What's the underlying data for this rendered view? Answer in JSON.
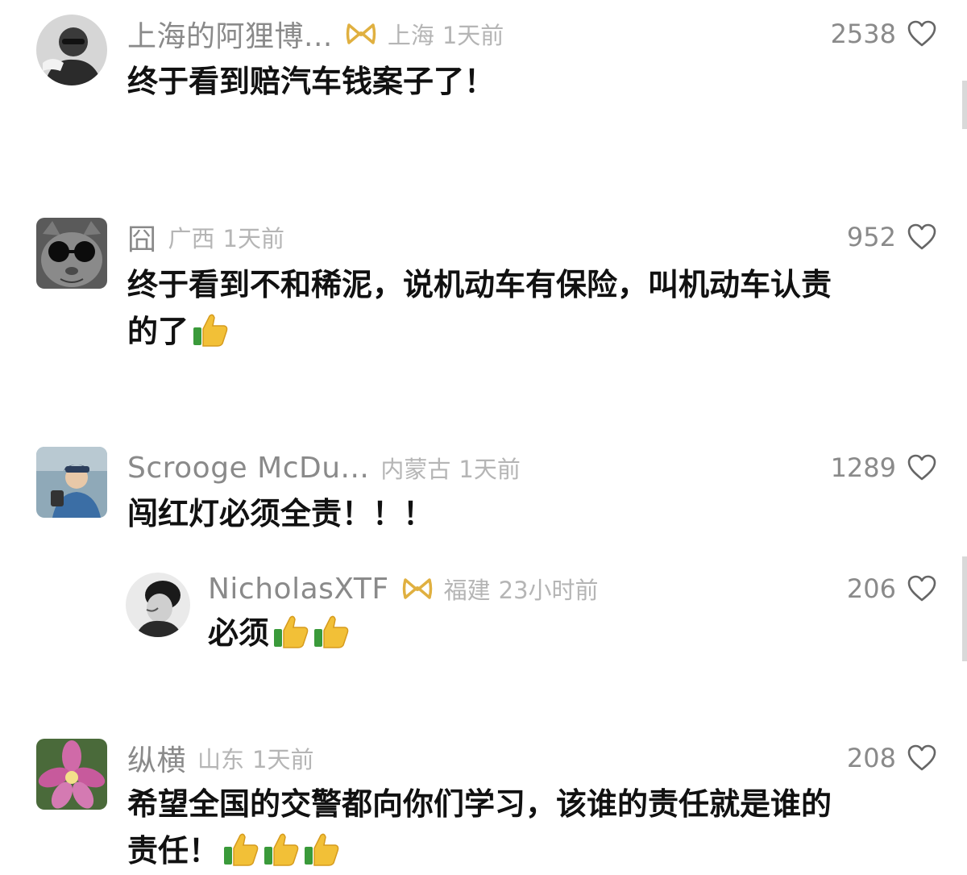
{
  "comments": [
    {
      "username": "上海的阿狸博...",
      "location": "上海",
      "time": "1天前",
      "likes": "2538",
      "text": "终于看到赔汽车钱案子了！",
      "avatar": "avatar-man-glasses"
    },
    {
      "username": "囧",
      "location": "广西",
      "time": "1天前",
      "likes": "952",
      "text_line1": "终于看到不和稀泥，说机动车有保险，叫机动车认责",
      "text_line2": "的了",
      "avatar": "avatar-cat-sunglasses"
    },
    {
      "username": "Scrooge McDu...",
      "location": "内蒙古",
      "time": "1天前",
      "likes": "1289",
      "text": "闯红灯必须全责！！！",
      "avatar": "avatar-man-cap"
    },
    {
      "username": "NicholasXTF",
      "location": "福建",
      "time": "23小时前",
      "likes": "206",
      "text": "必须",
      "avatar": "avatar-bw-portrait"
    },
    {
      "username": "纵横",
      "location": "山东",
      "time": "1天前",
      "likes": "208",
      "text_line1": "希望全国的交警都向你们学习，该谁的责任就是谁的",
      "text_line2": "责任！",
      "avatar": "avatar-pink-flower"
    }
  ],
  "icons": {
    "like": "heart-outline-icon",
    "badge": "gold-ribbon-badge-icon",
    "emoji": "thumbs-up-emoji"
  },
  "colors": {
    "username": "#8a8a8a",
    "meta": "#b5b5b5",
    "text": "#111111",
    "badge": "#e0b040"
  }
}
